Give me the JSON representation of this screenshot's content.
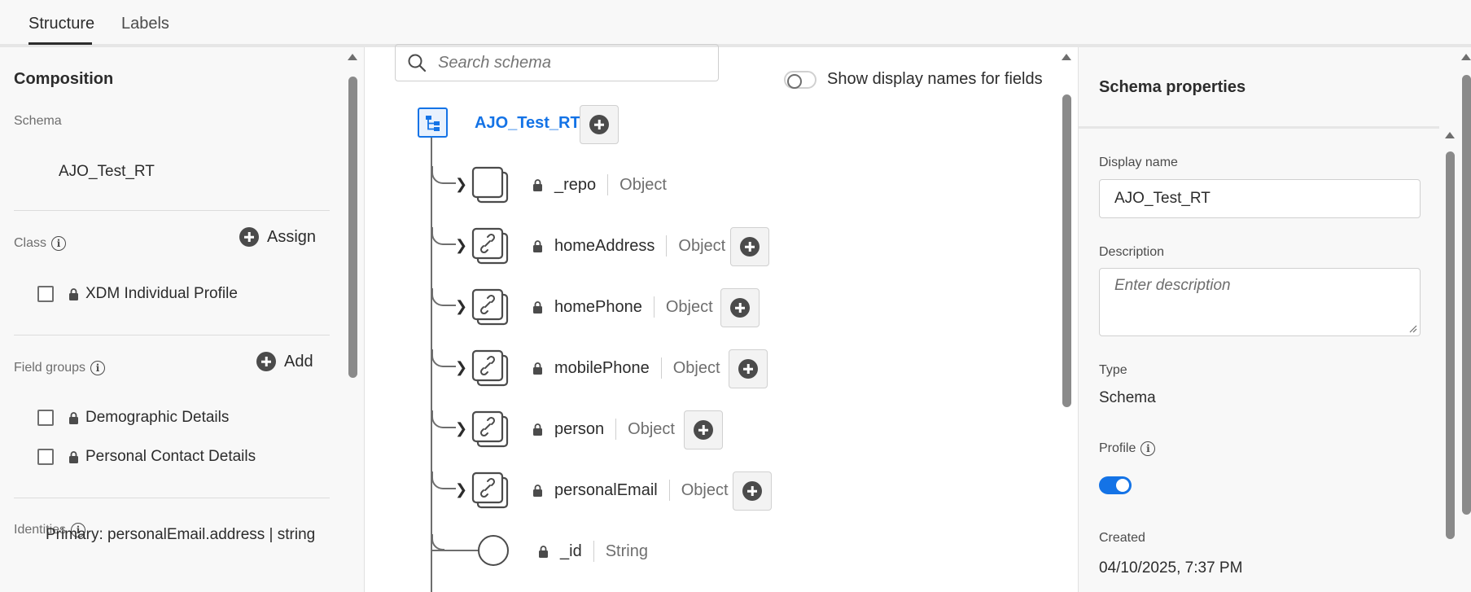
{
  "tabs": [
    {
      "label": "Structure",
      "active": true
    },
    {
      "label": "Labels",
      "active": false
    }
  ],
  "composition": {
    "title": "Composition",
    "schema_label": "Schema",
    "schema_name": "AJO_Test_RT",
    "class_label": "Class",
    "assign_label": "Assign",
    "class_items": [
      {
        "label": "XDM Individual Profile",
        "locked": true
      }
    ],
    "field_groups_label": "Field groups",
    "add_label": "Add",
    "field_groups": [
      {
        "label": "Demographic Details",
        "locked": true
      },
      {
        "label": "Personal Contact Details",
        "locked": true
      }
    ],
    "identities_label": "Identities",
    "identity_primary": "Primary: personalEmail.address | string"
  },
  "canvas": {
    "search_placeholder": "Search schema",
    "toggle_label": "Show display names for fields",
    "toggle_on": false,
    "root_name": "AJO_Test_RT",
    "fields": [
      {
        "name": "_repo",
        "type": "Object",
        "icon": "empty-object-icon",
        "expandable": true,
        "has_add": false
      },
      {
        "name": "homeAddress",
        "type": "Object",
        "icon": "link-object-icon",
        "expandable": true,
        "has_add": true
      },
      {
        "name": "homePhone",
        "type": "Object",
        "icon": "link-object-icon",
        "expandable": true,
        "has_add": true
      },
      {
        "name": "mobilePhone",
        "type": "Object",
        "icon": "link-object-icon",
        "expandable": true,
        "has_add": true
      },
      {
        "name": "person",
        "type": "Object",
        "icon": "link-object-icon",
        "expandable": true,
        "has_add": true
      },
      {
        "name": "personalEmail",
        "type": "Object",
        "icon": "link-object-icon",
        "expandable": true,
        "has_add": true
      },
      {
        "name": "_id",
        "type": "String",
        "icon": "circle-node-icon",
        "expandable": false,
        "has_add": false
      }
    ]
  },
  "properties": {
    "title": "Schema properties",
    "display_name_label": "Display name",
    "display_name_value": "AJO_Test_RT",
    "description_label": "Description",
    "description_placeholder": "Enter description",
    "type_label": "Type",
    "type_value": "Schema",
    "profile_label": "Profile",
    "profile_enabled": true,
    "created_label": "Created",
    "created_value": "04/10/2025, 7:37 PM"
  },
  "colors": {
    "accent": "#1473e6",
    "panel_bg": "#f8f8f8",
    "text": "#2c2c2c",
    "muted": "#6e6e6e"
  }
}
